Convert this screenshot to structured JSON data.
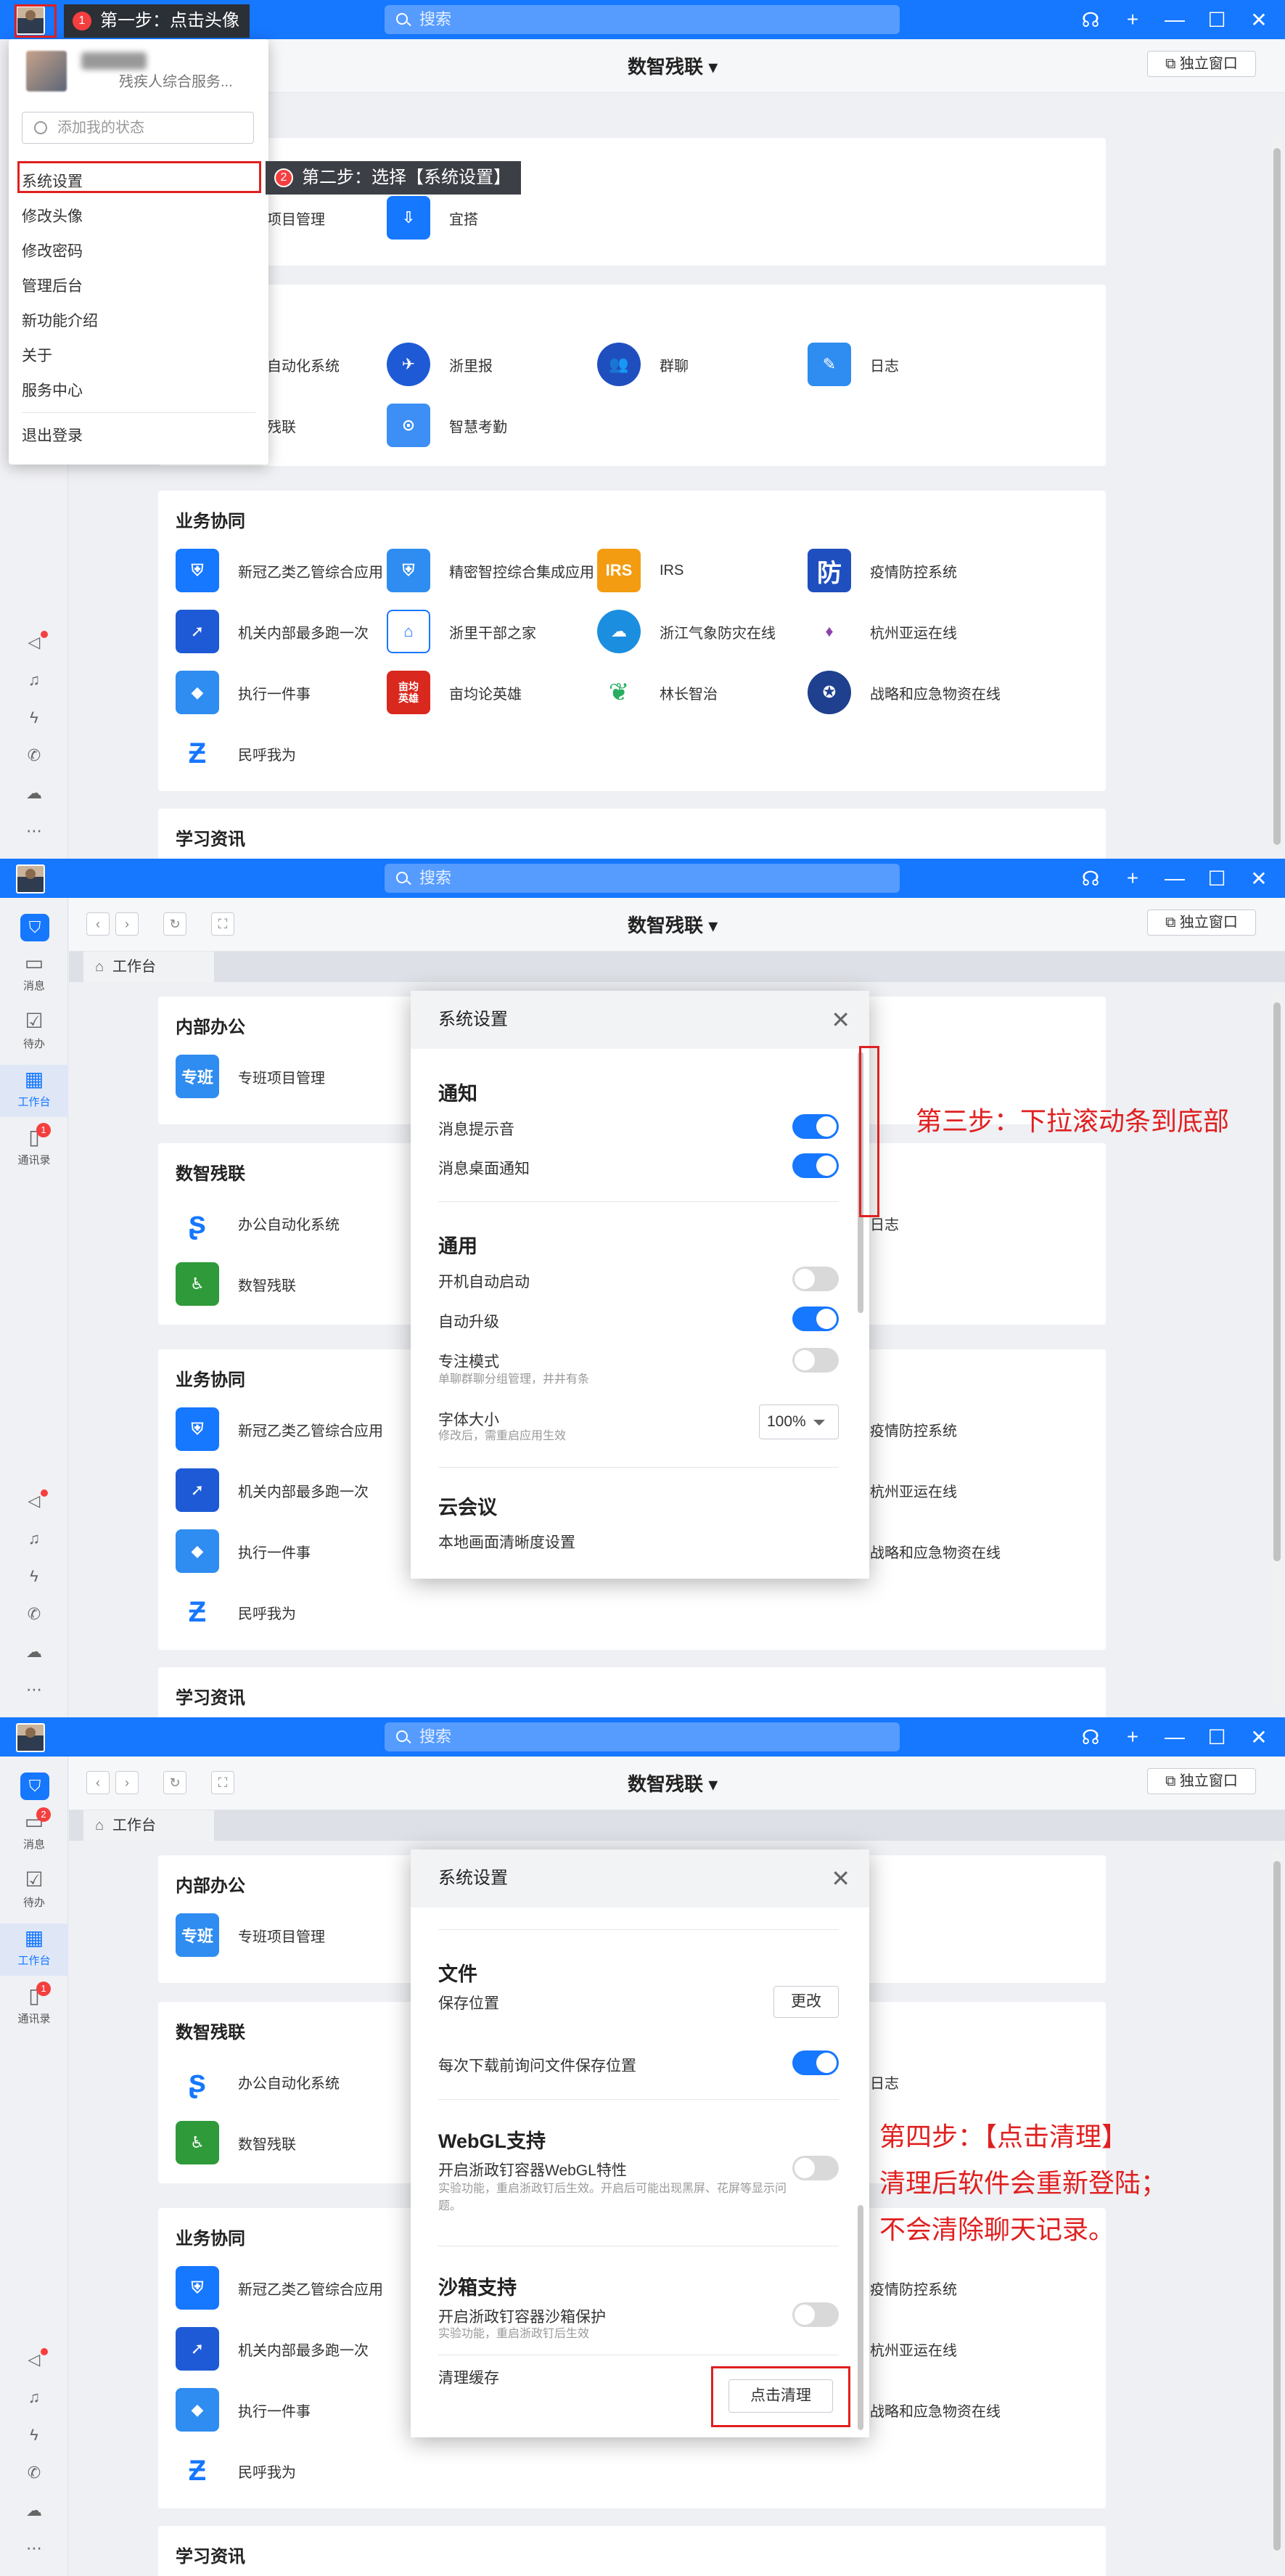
{
  "titlebar": {
    "search_placeholder": "搜索",
    "icons": [
      "headset-icon",
      "plus-icon",
      "minimize-icon",
      "maximize-icon",
      "close-icon"
    ]
  },
  "window": {
    "title": "数智残联 ▾",
    "independent_window": "独立窗口"
  },
  "tab": {
    "label": "工作台"
  },
  "nav": {
    "messages": "消息",
    "todo": "待办",
    "workbench": "工作台",
    "contacts": "通讯录",
    "contacts_badge": "1",
    "messages_badge": "2"
  },
  "sections": {
    "internal": {
      "title": "内部办公",
      "apps": [
        "专班项目管理",
        "宜搭"
      ]
    },
    "disabled": {
      "title": "数智残联",
      "apps": [
        "办公自动化系统",
        "浙里报",
        "群聊",
        "日志",
        "数智残联",
        "智慧考勤"
      ]
    },
    "business": {
      "title": "业务协同",
      "apps": [
        "新冠乙类乙管综合应用",
        "精密智控综合集成应用",
        "IRS",
        "疫情防控系统",
        "机关内部最多跑一次",
        "浙里干部之家",
        "浙江气象防灾在线",
        "杭州亚运在线",
        "执行一件事",
        "亩均论英雄",
        "林长智治",
        "战略和应急物资在线",
        "民呼我为"
      ]
    },
    "learning": {
      "title": "学习资讯"
    }
  },
  "icon_text": {
    "zhuanban": "专班",
    "irs": "IRS",
    "fang": "防",
    "muyun": "亩均\n英雄"
  },
  "dropdown": {
    "org": "残疾人综合服务...",
    "status_placeholder": "添加我的状态",
    "items": [
      "系统设置",
      "修改头像",
      "修改密码",
      "管理后台",
      "新功能介绍",
      "关于",
      "服务中心"
    ],
    "logout": "退出登录"
  },
  "steps": {
    "s1_num": "1",
    "s1": "第一步：点击头像",
    "s2_num": "2",
    "s2": "第二步：选择【系统设置】",
    "s3": "第三步：下拉滚动条到底部",
    "s4_l1": "第四步：【点击清理】",
    "s4_l2": "清理后软件会重新登陆；",
    "s4_l3": "不会清除聊天记录。"
  },
  "settings": {
    "title": "系统设置",
    "notify": {
      "title": "通知",
      "sound": "消息提示音",
      "desktop": "消息桌面通知"
    },
    "general": {
      "title": "通用",
      "autostart": "开机自动启动",
      "autoupdate": "自动升级",
      "focus": "专注模式",
      "focus_sub": "单聊群聊分组管理，井井有条",
      "fontsize": "字体大小",
      "fontsize_sub": "修改后，需重启应用生效",
      "fontsize_value": "100%"
    },
    "meeting": {
      "title": "云会议",
      "quality": "本地画面清晰度设置"
    },
    "file": {
      "title": "文件",
      "save_location": "保存位置",
      "change": "更改",
      "ask": "每次下载前询问文件保存位置"
    },
    "webgl": {
      "title": "WebGL支持",
      "enable": "开启浙政钉容器WebGL特性",
      "sub": "实验功能，重启浙政钉后生效。开启后可能出现黑屏、花屏等显示问题。"
    },
    "sandbox": {
      "title": "沙箱支持",
      "enable": "开启浙政钉容器沙箱保护",
      "sub": "实验功能，重启浙政钉后生效"
    },
    "cache": {
      "label": "清理缓存",
      "button": "点击清理"
    }
  },
  "colors": {
    "brand": "#1677ff",
    "annotation": "#e02020"
  }
}
